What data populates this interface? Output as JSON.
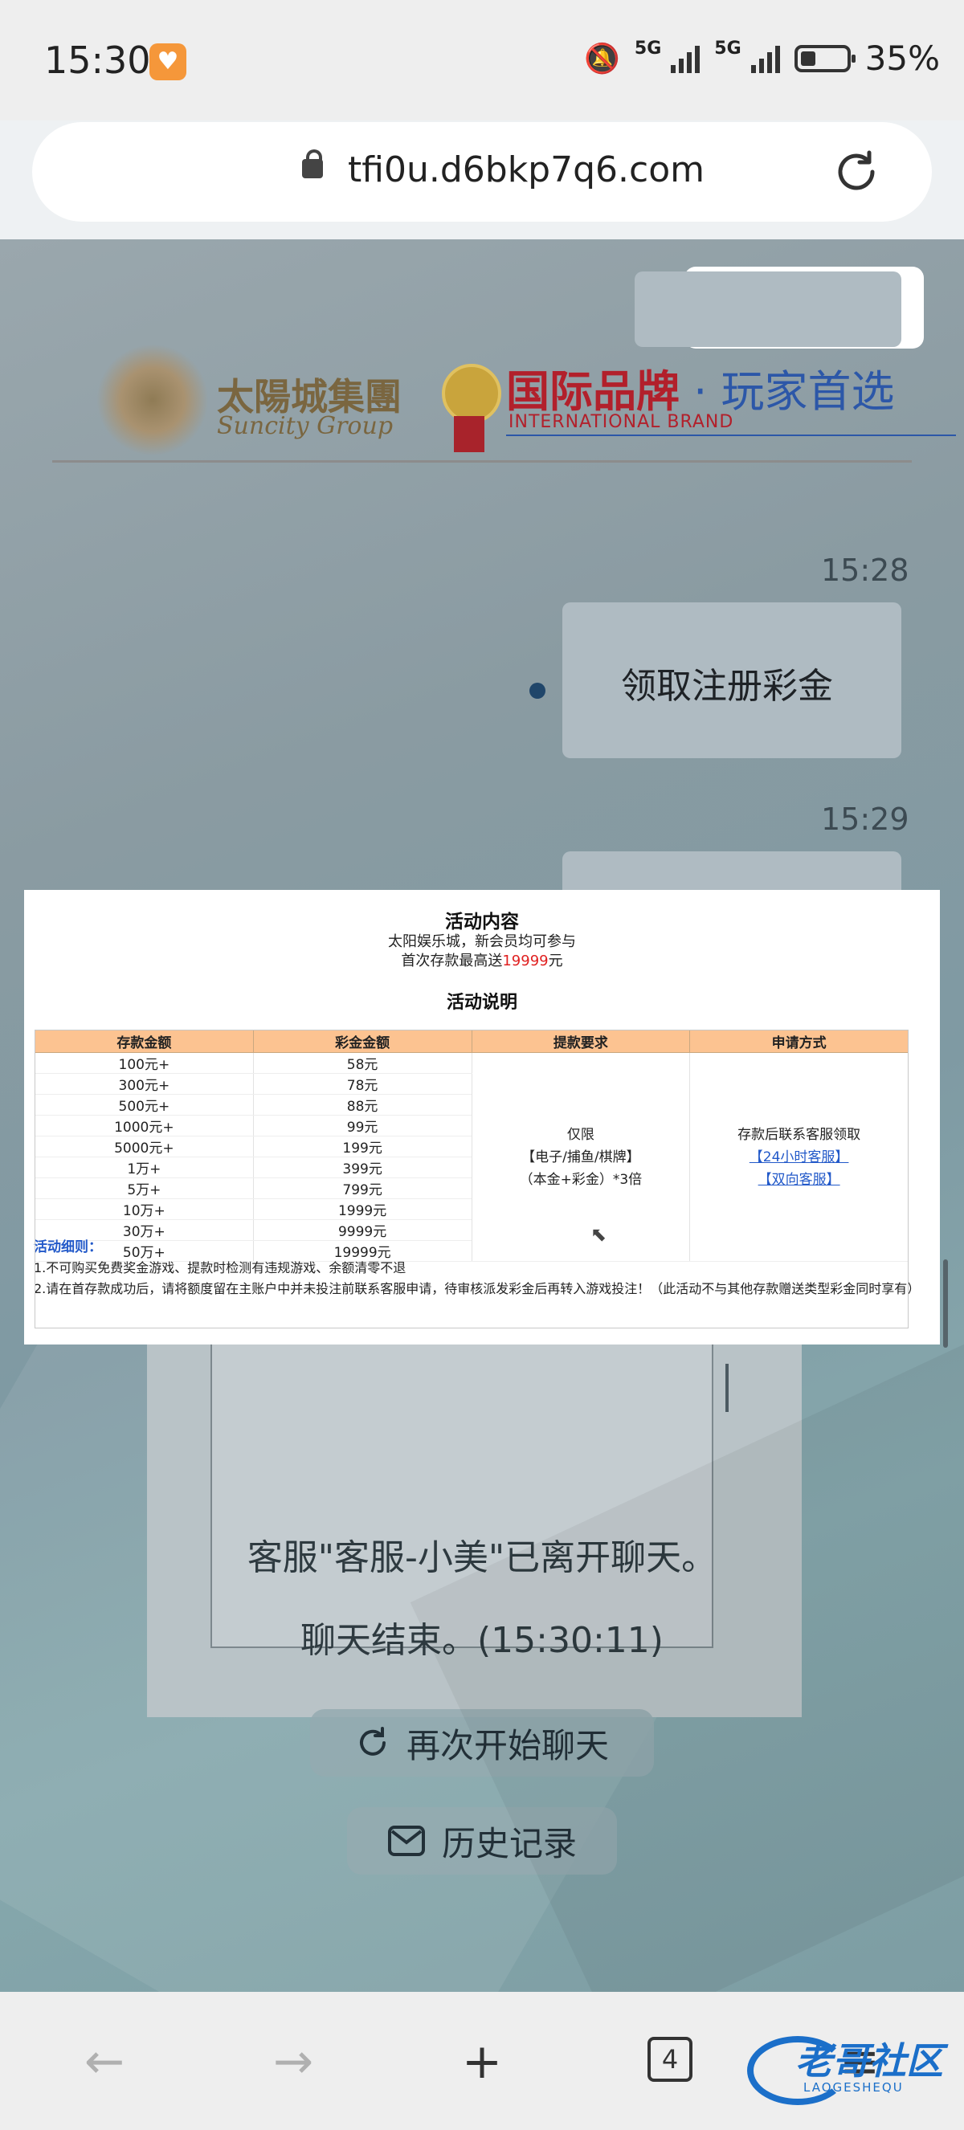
{
  "status_bar": {
    "time": "15:30",
    "network1": "5G",
    "network2": "5G",
    "battery": "35%"
  },
  "browser": {
    "url": "tfi0u.d6bkp7q6.com",
    "tab_count": "4"
  },
  "header_brand": {
    "group_cn": "太陽城集團",
    "group_en": "Suncity Group",
    "slogan_red": "国际品牌",
    "slogan_sep": " · ",
    "slogan_blue": "玩家首选",
    "slogan_en": "INTERNATIONAL BRAND"
  },
  "chat": {
    "msg_time_1": "15:28",
    "msg_text_1": "领取注册彩金",
    "msg_time_2": "15:29",
    "system_left": "客服\"客服-小美\"已离开聊天。",
    "system_end": "聊天结束。(15:30:11)",
    "restart_label": "再次开始聊天",
    "history_label": "历史记录"
  },
  "promo": {
    "title": "活动内容",
    "line1": "太阳娱乐城，新会员均可参与",
    "line2_pre": "首次存款最高送",
    "line2_amount": "19999",
    "line2_post": "元",
    "subtitle": "活动说明",
    "headers": [
      "存款金额",
      "彩金金额",
      "提款要求",
      "申请方式"
    ],
    "rows": [
      [
        "100元+",
        "58元"
      ],
      [
        "300元+",
        "78元"
      ],
      [
        "500元+",
        "88元"
      ],
      [
        "1000元+",
        "99元"
      ],
      [
        "5000元+",
        "199元"
      ],
      [
        "1万+",
        "399元"
      ],
      [
        "5万+",
        "799元"
      ],
      [
        "10万+",
        "1999元"
      ],
      [
        "30万+",
        "9999元"
      ],
      [
        "50万+",
        "19999元"
      ]
    ],
    "req_line1": "仅限",
    "req_line2": "【电子/捕鱼/棋牌】",
    "req_line3": "（本金+彩金）*3倍",
    "apply_line1": "存款后联系客服领取",
    "apply_link1": "【24小时客服】",
    "apply_link2": "【双向客服】",
    "rules_title": "活动细则：",
    "rule1": "1.不可购买免费奖金游戏、提款时检测有违规游戏、余额清零不退",
    "rule2": "2.请在首存款成功后，请将额度留在主账户中并未投注前联系客服申请，待审核派发彩金后再转入游戏投注！（此活动不与其他存款赠送类型彩金同时享有）"
  },
  "watermark": {
    "main": "老哥社区",
    "sub": "LAOGESHEQU"
  }
}
